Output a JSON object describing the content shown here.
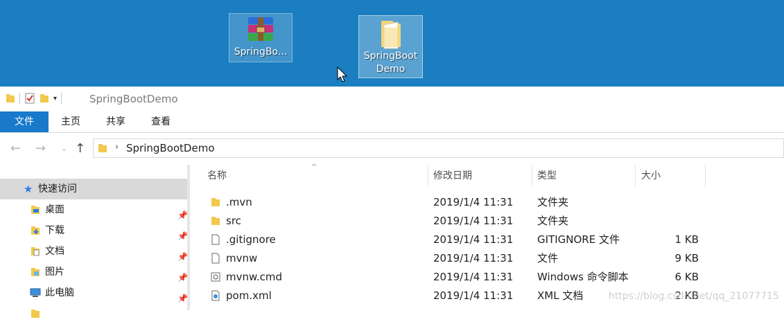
{
  "desktop": {
    "icons": [
      {
        "label": "SpringBo...",
        "icon": "winrar-archive-icon"
      },
      {
        "label_line1": "SpringBoot",
        "label_line2": "Demo",
        "icon": "folder-icon"
      }
    ]
  },
  "window": {
    "title": "SpringBootDemo",
    "ribbon_tabs": [
      "文件",
      "主页",
      "共享",
      "查看"
    ],
    "accent_color": "#1979ca"
  },
  "address": {
    "crumb": "SpringBootDemo"
  },
  "nav": {
    "quick_access": "快速访问",
    "items": [
      {
        "label": "桌面",
        "icon": "desktop-folder-icon",
        "pinned": true
      },
      {
        "label": "下载",
        "icon": "downloads-folder-icon",
        "pinned": true
      },
      {
        "label": "文档",
        "icon": "documents-folder-icon",
        "pinned": true
      },
      {
        "label": "图片",
        "icon": "pictures-folder-icon",
        "pinned": true
      },
      {
        "label": "此电脑",
        "icon": "this-pc-icon",
        "pinned": true
      }
    ]
  },
  "columns": {
    "name": "名称",
    "date": "修改日期",
    "type": "类型",
    "size": "大小"
  },
  "files": [
    {
      "name": ".mvn",
      "date": "2019/1/4 11:31",
      "type": "文件夹",
      "size": "",
      "icon": "folder-icon"
    },
    {
      "name": "src",
      "date": "2019/1/4 11:31",
      "type": "文件夹",
      "size": "",
      "icon": "folder-icon"
    },
    {
      "name": ".gitignore",
      "date": "2019/1/4 11:31",
      "type": "GITIGNORE 文件",
      "size": "1 KB",
      "icon": "file-icon"
    },
    {
      "name": "mvnw",
      "date": "2019/1/4 11:31",
      "type": "文件",
      "size": "9 KB",
      "icon": "file-icon"
    },
    {
      "name": "mvnw.cmd",
      "date": "2019/1/4 11:31",
      "type": "Windows 命令脚本",
      "size": "6 KB",
      "icon": "cmd-script-icon"
    },
    {
      "name": "pom.xml",
      "date": "2019/1/4 11:31",
      "type": "XML 文档",
      "size": "2 KB",
      "icon": "xml-file-icon"
    }
  ],
  "watermark": "https://blog.csdn.net/qq_21077715"
}
